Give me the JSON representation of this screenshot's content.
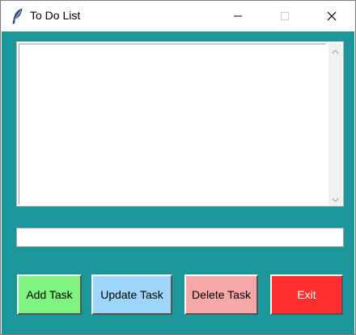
{
  "window": {
    "title": "To Do List"
  },
  "entry": {
    "value": ""
  },
  "buttons": {
    "add": "Add Task",
    "update": "Update Task",
    "delete": "Delete Task",
    "exit": "Exit"
  },
  "colors": {
    "background": "#1b9699",
    "add": "#7ff37f",
    "update": "#9ed6fb",
    "delete": "#f7a8a8",
    "exit": "#ff2f2f"
  },
  "icons": {
    "app": "feather-icon",
    "minimize": "minimize-icon",
    "maximize": "maximize-icon",
    "close": "close-icon"
  }
}
